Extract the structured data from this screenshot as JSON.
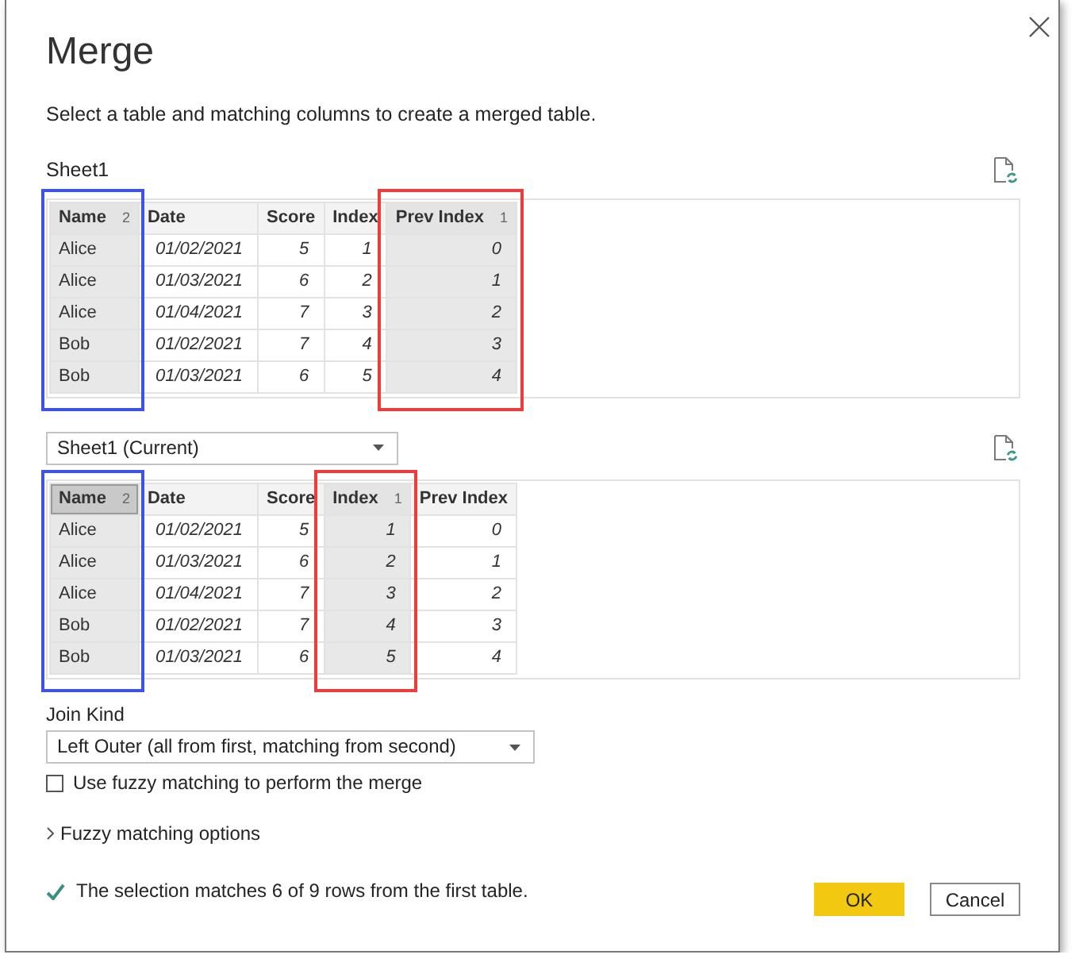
{
  "dialog": {
    "title": "Merge",
    "description": "Select a table and matching columns to create a merged table."
  },
  "first_table": {
    "label": "Sheet1",
    "columns": [
      {
        "name": "Name",
        "kind": "text",
        "selected": true,
        "focused": false,
        "order": "2",
        "frame": {
          "color": "#3d52e8"
        }
      },
      {
        "name": "Date",
        "kind": "value",
        "selected": false,
        "focused": false
      },
      {
        "name": "Score",
        "kind": "value",
        "selected": false,
        "focused": false
      },
      {
        "name": "Index",
        "kind": "value",
        "selected": false,
        "focused": false
      },
      {
        "name": "Prev Index",
        "kind": "value",
        "selected": true,
        "focused": false,
        "order": "1",
        "frame": {
          "color": "#ee3b3b"
        }
      }
    ],
    "rows": [
      [
        "Alice",
        "01/02/2021",
        "5",
        "1",
        "0"
      ],
      [
        "Alice",
        "01/03/2021",
        "6",
        "2",
        "1"
      ],
      [
        "Alice",
        "01/04/2021",
        "7",
        "3",
        "2"
      ],
      [
        "Bob",
        "01/02/2021",
        "7",
        "4",
        "3"
      ],
      [
        "Bob",
        "01/03/2021",
        "6",
        "5",
        "4"
      ]
    ]
  },
  "second_table": {
    "selector": "Sheet1 (Current)",
    "columns": [
      {
        "name": "Name",
        "kind": "text",
        "selected": true,
        "focused": true,
        "order": "2",
        "frame": {
          "color": "#3d52e8"
        }
      },
      {
        "name": "Date",
        "kind": "value",
        "selected": false,
        "focused": false
      },
      {
        "name": "Score",
        "kind": "value",
        "selected": false,
        "focused": false
      },
      {
        "name": "Index",
        "kind": "value",
        "selected": true,
        "focused": false,
        "order": "1",
        "frame": {
          "color": "#ee3b3b"
        }
      },
      {
        "name": "Prev Index",
        "kind": "value",
        "selected": false,
        "focused": false
      }
    ],
    "rows": [
      [
        "Alice",
        "01/02/2021",
        "5",
        "1",
        "0"
      ],
      [
        "Alice",
        "01/03/2021",
        "6",
        "2",
        "1"
      ],
      [
        "Alice",
        "01/04/2021",
        "7",
        "3",
        "2"
      ],
      [
        "Bob",
        "01/02/2021",
        "7",
        "4",
        "3"
      ],
      [
        "Bob",
        "01/03/2021",
        "6",
        "5",
        "4"
      ]
    ]
  },
  "join_kind": {
    "label": "Join Kind",
    "value": "Left Outer (all from first, matching from second)"
  },
  "fuzzy_checkbox": {
    "label": "Use fuzzy matching to perform the merge",
    "checked": false
  },
  "fuzzy_options": {
    "label": "Fuzzy matching options",
    "expanded": false
  },
  "status": {
    "text": "The selection matches 6 of 9 rows from the first table."
  },
  "buttons": [
    {
      "label": "OK",
      "kind": "primary"
    },
    {
      "label": "Cancel",
      "kind": "secondary"
    }
  ]
}
